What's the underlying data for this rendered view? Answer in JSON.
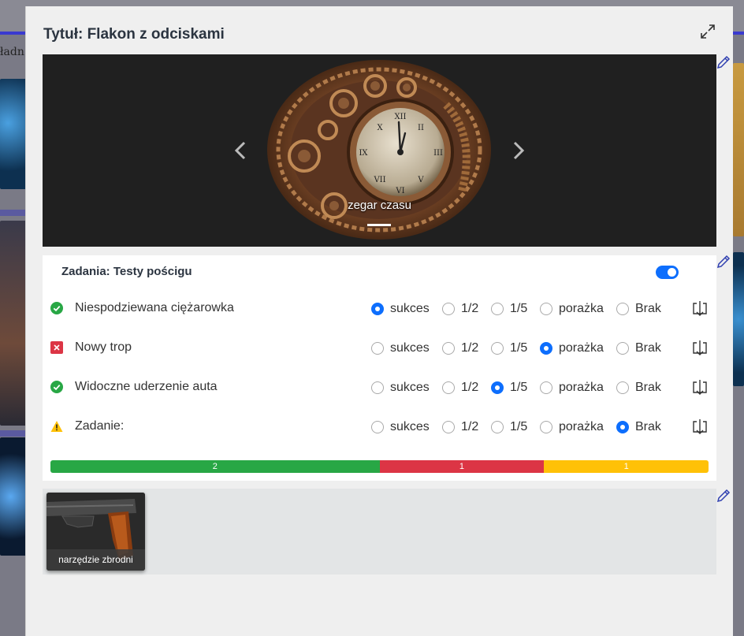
{
  "background": {
    "left_fragment": "ładn"
  },
  "modal": {
    "title": "Tytuł: Flakon z odciskami",
    "expand_icon": "expand-arrows-icon",
    "edit_icon": "pencil-icon"
  },
  "carousel": {
    "caption": "zegar czasu",
    "slide_index": 1,
    "slide_count": 1
  },
  "tasks": {
    "title": "Zadania: Testy pościgu",
    "toggle_on": true,
    "options": [
      "sukces",
      "1/2",
      "1/5",
      "porażka",
      "Brak"
    ],
    "rows": [
      {
        "label": "Niespodziewana ciężarowka",
        "status": "success",
        "selected": "sukces"
      },
      {
        "label": "Nowy trop",
        "status": "failure",
        "selected": "porażka"
      },
      {
        "label": "Widoczne uderzenie auta",
        "status": "success",
        "selected": "1/5"
      },
      {
        "label": "Zadanie:",
        "status": "warning",
        "selected": "Brak"
      }
    ],
    "progress": [
      {
        "value": 2,
        "label": "2",
        "color": "#28a745"
      },
      {
        "value": 1,
        "label": "1",
        "color": "#dc3545"
      },
      {
        "value": 1,
        "label": "1",
        "color": "#ffc107"
      }
    ]
  },
  "items": [
    {
      "caption": "narzędzie zbrodni"
    }
  ],
  "colors": {
    "accent": "#0d6efd",
    "success": "#28a745",
    "danger": "#dc3545",
    "warning": "#ffc107"
  }
}
